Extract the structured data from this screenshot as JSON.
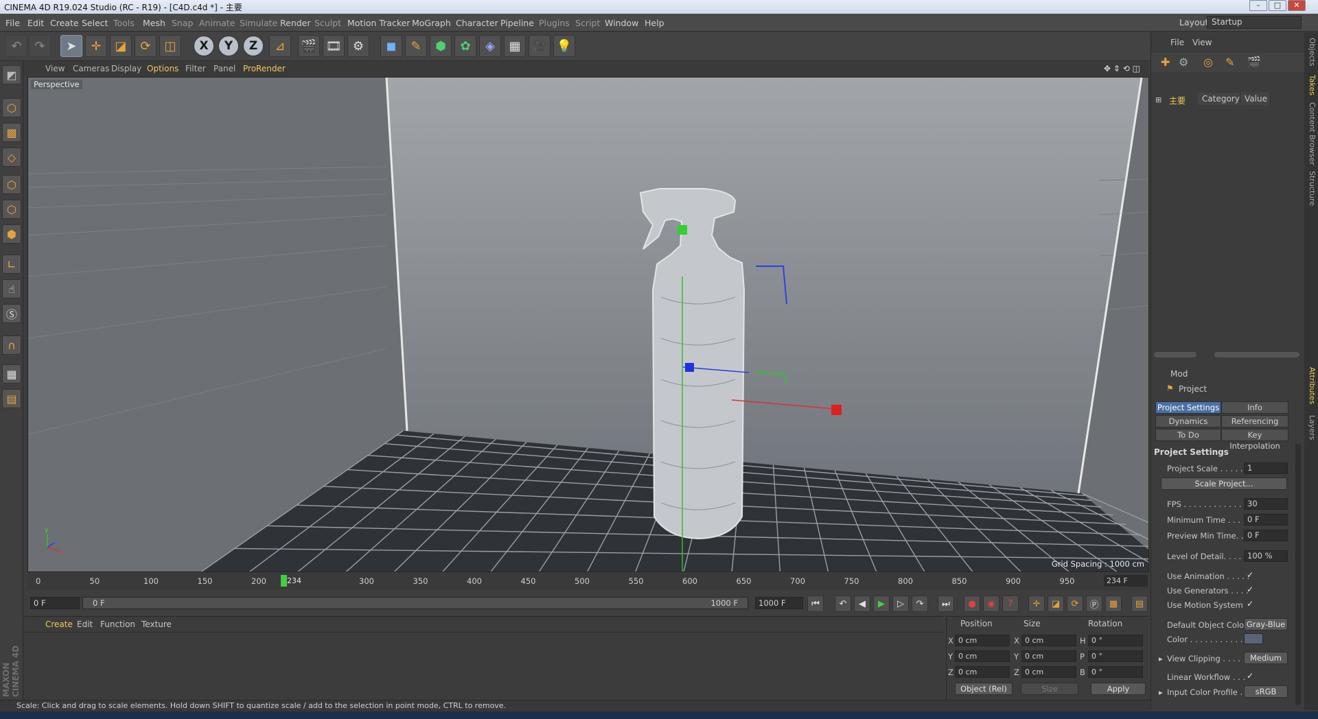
{
  "window": {
    "title": "CINEMA 4D R19.024 Studio (RC - R19) - [C4D.c4d *] - 主要"
  },
  "menu": [
    "File",
    "Edit",
    "Create",
    "Select",
    "Tools",
    "Mesh",
    "Snap",
    "Animate",
    "Simulate",
    "Render",
    "Sculpt",
    "Motion Tracker",
    "MoGraph",
    "Character",
    "Pipeline",
    "Plugins",
    "Script",
    "Window",
    "Help"
  ],
  "layout": {
    "label": "Layout:",
    "value": "Startup"
  },
  "toolbar": {
    "icons": [
      "undo-icon",
      "redo-icon",
      "select-live-icon",
      "move-icon",
      "scale-icon",
      "rotate-icon",
      "recent-tool-icon",
      "x-axis-icon",
      "y-axis-icon",
      "z-axis-icon",
      "coordinate-system-icon",
      "render-view-icon",
      "render-picture-viewer-icon",
      "render-settings-icon",
      "cube-icon",
      "pen-icon",
      "subdivision-icon",
      "cloner-icon",
      "deformer-icon",
      "floor-icon",
      "camera-icon",
      "light-icon"
    ],
    "axis_labels": [
      "X",
      "Y",
      "Z"
    ]
  },
  "viewport": {
    "menu": [
      "View",
      "Cameras",
      "Display",
      "Options",
      "Filter",
      "Panel",
      "ProRender"
    ],
    "label": "Perspective",
    "grid_spacing": "Grid Spacing : 1000 cm",
    "axis_labels": [
      "y",
      "z",
      "x"
    ]
  },
  "timeline": {
    "ticks": [
      "0",
      "50",
      "100",
      "150",
      "200",
      "234",
      "300",
      "350",
      "400",
      "450",
      "500",
      "550",
      "600",
      "650",
      "700",
      "750",
      "800",
      "850",
      "900",
      "950",
      "100"
    ],
    "current_frame": "234 F",
    "playhead_label": "234",
    "start_field": "0 F",
    "range_start": "0 F",
    "range_end": "1000 F",
    "end_field": "1000 F"
  },
  "material_manager": {
    "menu": [
      "Create",
      "Edit",
      "Function",
      "Texture"
    ]
  },
  "coordinates": {
    "headers": [
      "Position",
      "Size",
      "Rotation"
    ],
    "rows": [
      {
        "axis": "X",
        "pos": "0 cm",
        "size_axis": "X",
        "size": "0 cm",
        "rot_axis": "H",
        "rot": "0 °"
      },
      {
        "axis": "Y",
        "pos": "0 cm",
        "size_axis": "Y",
        "size": "0 cm",
        "rot_axis": "P",
        "rot": "0 °"
      },
      {
        "axis": "Z",
        "pos": "0 cm",
        "size_axis": "Z",
        "size": "0 cm",
        "rot_axis": "B",
        "rot": "0 °"
      }
    ],
    "mode": "Object (Rel)",
    "size_mode": "Size",
    "apply": "Apply"
  },
  "object_manager": {
    "menu": [
      "File",
      "View"
    ],
    "take": "主要",
    "columns": [
      "Category",
      "Value"
    ]
  },
  "attributes": {
    "menu": "Mod",
    "title": "Project",
    "tabs": [
      "Project Settings",
      "Info",
      "Dynamics",
      "Referencing",
      "To Do",
      "Key Interpolation"
    ],
    "section": "Project Settings",
    "scale_project": "Scale Project...",
    "rows": [
      {
        "label": "Project Scale . . . . . .",
        "value": "1"
      },
      {
        "label": "FPS . . . . . . . . . . . . . .",
        "value": "30"
      },
      {
        "label": "Minimum Time . . . .",
        "value": "0 F"
      },
      {
        "label": "Preview Min Time. . .",
        "value": "0 F"
      },
      {
        "label": "Level of Detail. . . . .",
        "value": "100 %"
      }
    ],
    "checks": [
      {
        "label": "Use Animation . . . . .",
        "value": "✓"
      },
      {
        "label": "Use Generators . . . .",
        "value": "✓"
      },
      {
        "label": "Use Motion System",
        "value": "✓"
      }
    ],
    "default_object_color": {
      "label": "Default Object Color",
      "value": "Gray-Blue"
    },
    "color": {
      "label": "Color . . . . . . . . . . ."
    },
    "view_clipping": {
      "label": "View Clipping . . . . .",
      "value": "Medium"
    },
    "linear_workflow": {
      "label": "Linear Workflow . . .",
      "value": "✓"
    },
    "input_color_profile": {
      "label": "Input Color Profile . .",
      "value": "sRGB"
    }
  },
  "right_tabs": [
    "Objects",
    "Takes",
    "Content Browser",
    "Structure",
    "Attributes",
    "Layers"
  ],
  "status": "Scale: Click and drag to scale elements. Hold down SHIFT to quantize scale / add to the selection in point mode, CTRL to remove.",
  "brand": "MAXON CINEMA 4D",
  "colors": {
    "accent": "#f0c85a",
    "tab_active": "#4a6fa5",
    "playhead": "#40d040",
    "x_axis": "#e03030",
    "y_axis": "#30c030",
    "z_axis": "#3040e0"
  }
}
